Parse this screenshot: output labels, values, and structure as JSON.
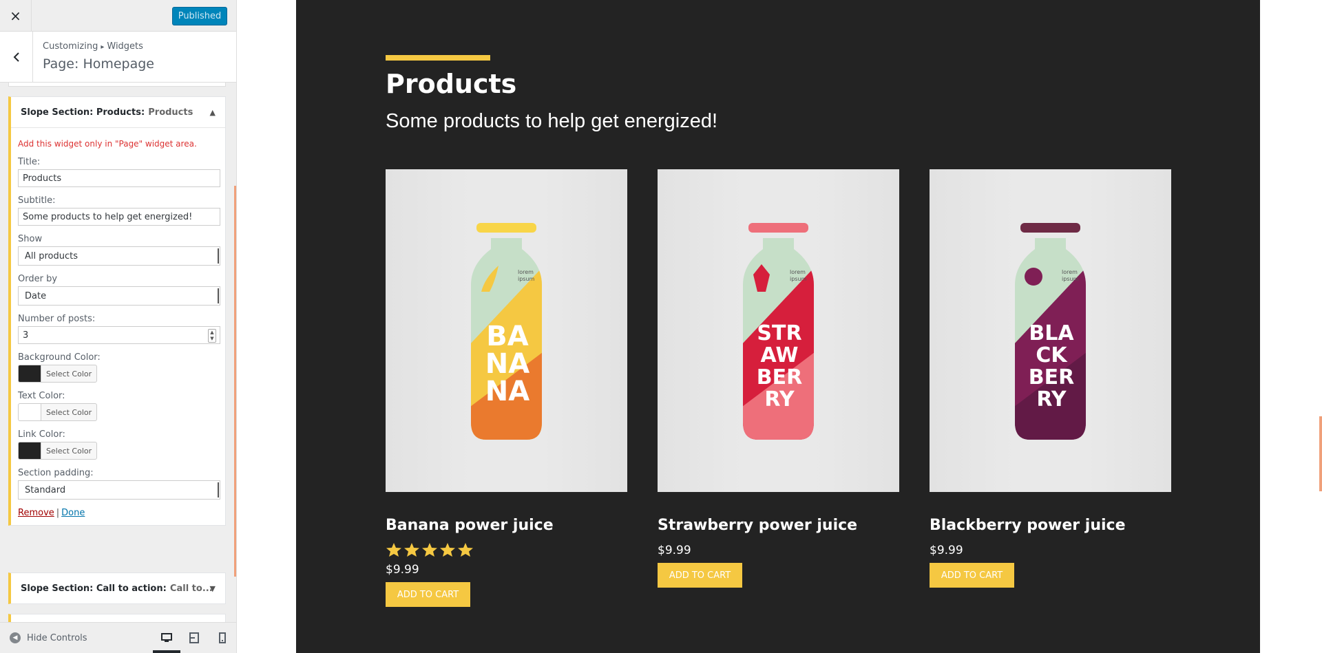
{
  "topbar": {
    "close_icon": "×",
    "publish_label": "Published"
  },
  "panel": {
    "breadcrumb_root": "Customizing",
    "breadcrumb_sep": "▸",
    "breadcrumb_section": "Widgets",
    "title": "Page: Homepage"
  },
  "widget_products": {
    "title": "Slope Section: Products:",
    "subtitle": "Products",
    "arrow": "▲",
    "warning": "Add this widget only in \"Page\" widget area.",
    "fields": {
      "title_label": "Title:",
      "title_value": "Products",
      "subtitle_label": "Subtitle:",
      "subtitle_value": "Some products to help get energized!",
      "show_label": "Show",
      "show_value": "All products",
      "orderby_label": "Order by",
      "orderby_value": "Date",
      "num_posts_label": "Number of posts:",
      "num_posts_value": "3",
      "bg_color_label": "Background Color:",
      "bg_color_value": "#232323",
      "text_color_label": "Text Color:",
      "text_color_value": "#ffffff",
      "link_color_label": "Link Color:",
      "link_color_value": "#232323",
      "select_color_label": "Select Color",
      "padding_label": "Section padding:",
      "padding_value": "Standard"
    },
    "remove_label": "Remove",
    "pipe": "|",
    "done_label": "Done"
  },
  "widget_cta": {
    "title": "Slope Section: Call to action:",
    "subtitle": "Call to...",
    "arrow": "▼"
  },
  "footer": {
    "hide_icon": "◀",
    "hide_label": "Hide Controls",
    "devices": [
      "desktop-icon",
      "tablet-icon",
      "mobile-icon"
    ]
  },
  "preview": {
    "section_title": "Products",
    "section_subtitle": "Some products to help get energized!",
    "accent_color": "#f5c842",
    "products": [
      {
        "name": "Banana power juice",
        "rating_stars": 5,
        "price": "$9.99",
        "button": "ADD TO CART",
        "label": [
          "BA",
          "NA",
          "NA"
        ],
        "bottle_brand": [
          "lorem",
          "ipsum"
        ],
        "cap_color": "#f8d548",
        "colors": {
          "top": "#c6dfc8",
          "mid": "#f5c842",
          "bottom": "#ea7a2e"
        }
      },
      {
        "name": "Strawberry power juice",
        "price": "$9.99",
        "button": "ADD TO CART",
        "label": [
          "STR",
          "AW",
          "BER",
          "RY"
        ],
        "bottle_brand": [
          "lorem",
          "ipsum"
        ],
        "cap_color": "#ee6f7a",
        "colors": {
          "top": "#c6dfc8",
          "mid": "#d61f3c",
          "bottom": "#ee6f7a"
        }
      },
      {
        "name": "Blackberry power juice",
        "price": "$9.99",
        "button": "ADD TO CART",
        "label": [
          "BLA",
          "CK",
          "BER",
          "RY"
        ],
        "bottle_brand": [
          "lorem",
          "ipsum"
        ],
        "cap_color": "#6e2a45",
        "colors": {
          "top": "#c6dfc8",
          "mid": "#7f1f55",
          "bottom": "#621a46"
        }
      }
    ]
  }
}
